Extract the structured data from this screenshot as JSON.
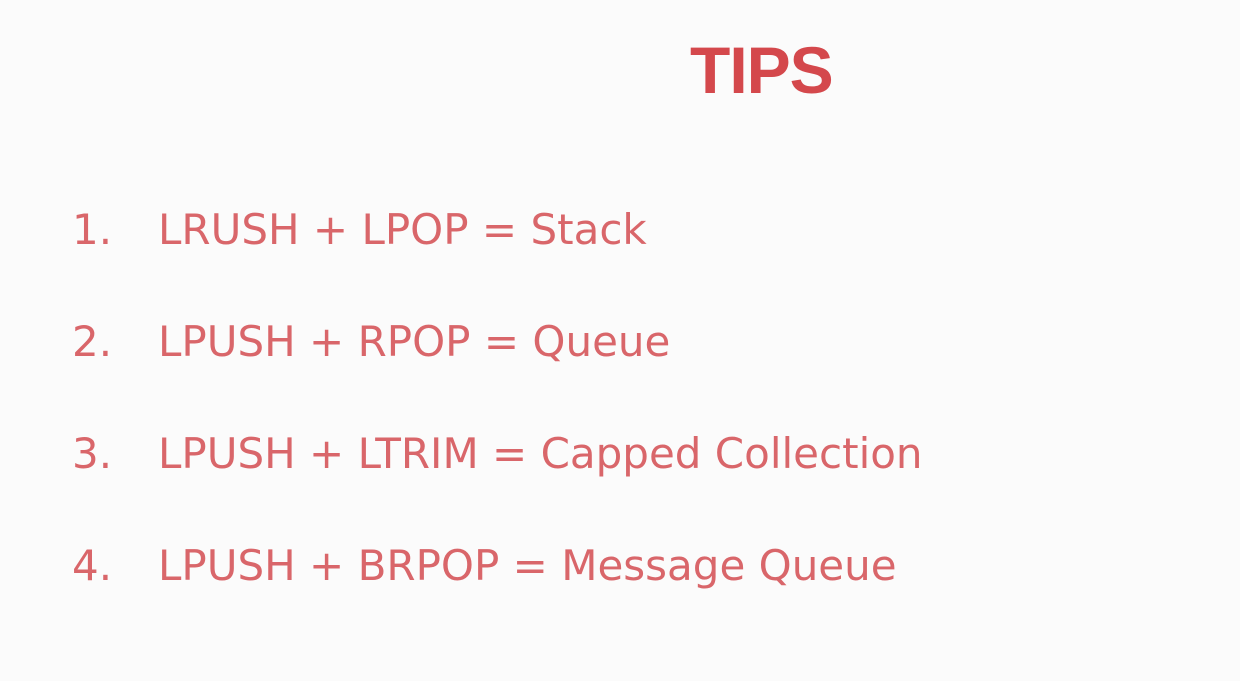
{
  "slide": {
    "title": "TIPS",
    "title_color": "#d4484c",
    "text_color": "#d9666a",
    "background": "#fbfbfb",
    "tips": [
      {
        "number": "1.",
        "text": "LRUSH + LPOP = Stack"
      },
      {
        "number": "2.",
        "text": "LPUSH + RPOP = Queue"
      },
      {
        "number": "3.",
        "text": "LPUSH + LTRIM = Capped Collection"
      },
      {
        "number": "4.",
        "text": "LPUSH + BRPOP = Message Queue"
      }
    ]
  }
}
